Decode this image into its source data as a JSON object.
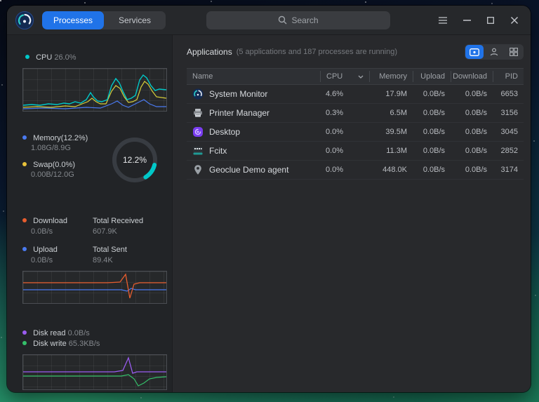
{
  "titlebar": {
    "tabs": [
      {
        "label": "Processes",
        "active": true
      },
      {
        "label": "Services",
        "active": false
      }
    ],
    "search_placeholder": "Search"
  },
  "sidebar": {
    "cpu_label": "CPU",
    "cpu_value": "26.0%",
    "memory_label": "Memory(12.2%)",
    "memory_detail": "1.08G/8.9G",
    "swap_label": "Swap(0.0%)",
    "swap_detail": "0.00B/12.0G",
    "ring_percent": "12.2%",
    "download_label": "Download",
    "download_value": "0.0B/s",
    "total_received_label": "Total Received",
    "total_received_value": "607.9K",
    "upload_label": "Upload",
    "upload_value": "0.0B/s",
    "total_sent_label": "Total Sent",
    "total_sent_value": "89.4K",
    "disk_read_label": "Disk read",
    "disk_read_value": "0.0B/s",
    "disk_write_label": "Disk write",
    "disk_write_value": "65.3KB/s"
  },
  "main": {
    "title": "Applications",
    "subtitle": "(5 applications and 187 processes are running)",
    "table": {
      "columns": [
        "Name",
        "CPU",
        "Memory",
        "Upload",
        "Download",
        "PID"
      ],
      "rows": [
        {
          "name": "System Monitor",
          "cpu": "4.6%",
          "memory": "17.9M",
          "upload": "0.0B/s",
          "download": "0.0B/s",
          "pid": "6653"
        },
        {
          "name": "Printer Manager",
          "cpu": "0.3%",
          "memory": "6.5M",
          "upload": "0.0B/s",
          "download": "0.0B/s",
          "pid": "3156"
        },
        {
          "name": "Desktop",
          "cpu": "0.0%",
          "memory": "39.5M",
          "upload": "0.0B/s",
          "download": "0.0B/s",
          "pid": "3045"
        },
        {
          "name": "Fcitx",
          "cpu": "0.0%",
          "memory": "11.3M",
          "upload": "0.0B/s",
          "download": "0.0B/s",
          "pid": "2852"
        },
        {
          "name": "Geoclue Demo agent",
          "cpu": "0.0%",
          "memory": "448.0K",
          "upload": "0.0B/s",
          "download": "0.0B/s",
          "pid": "3174"
        }
      ]
    }
  },
  "colors": {
    "accent": "#2073e8",
    "cpu_line": "#00c8c8",
    "cpu_line_alt": "#d8cf3a",
    "memory_dot": "#4a7af0",
    "swap_dot": "#e8c23a",
    "download_dot": "#e85d2e",
    "upload_dot": "#4a7af0",
    "disk_read_dot": "#9a5cf0",
    "disk_write_dot": "#35c06a",
    "ring": "#00c8c8"
  }
}
